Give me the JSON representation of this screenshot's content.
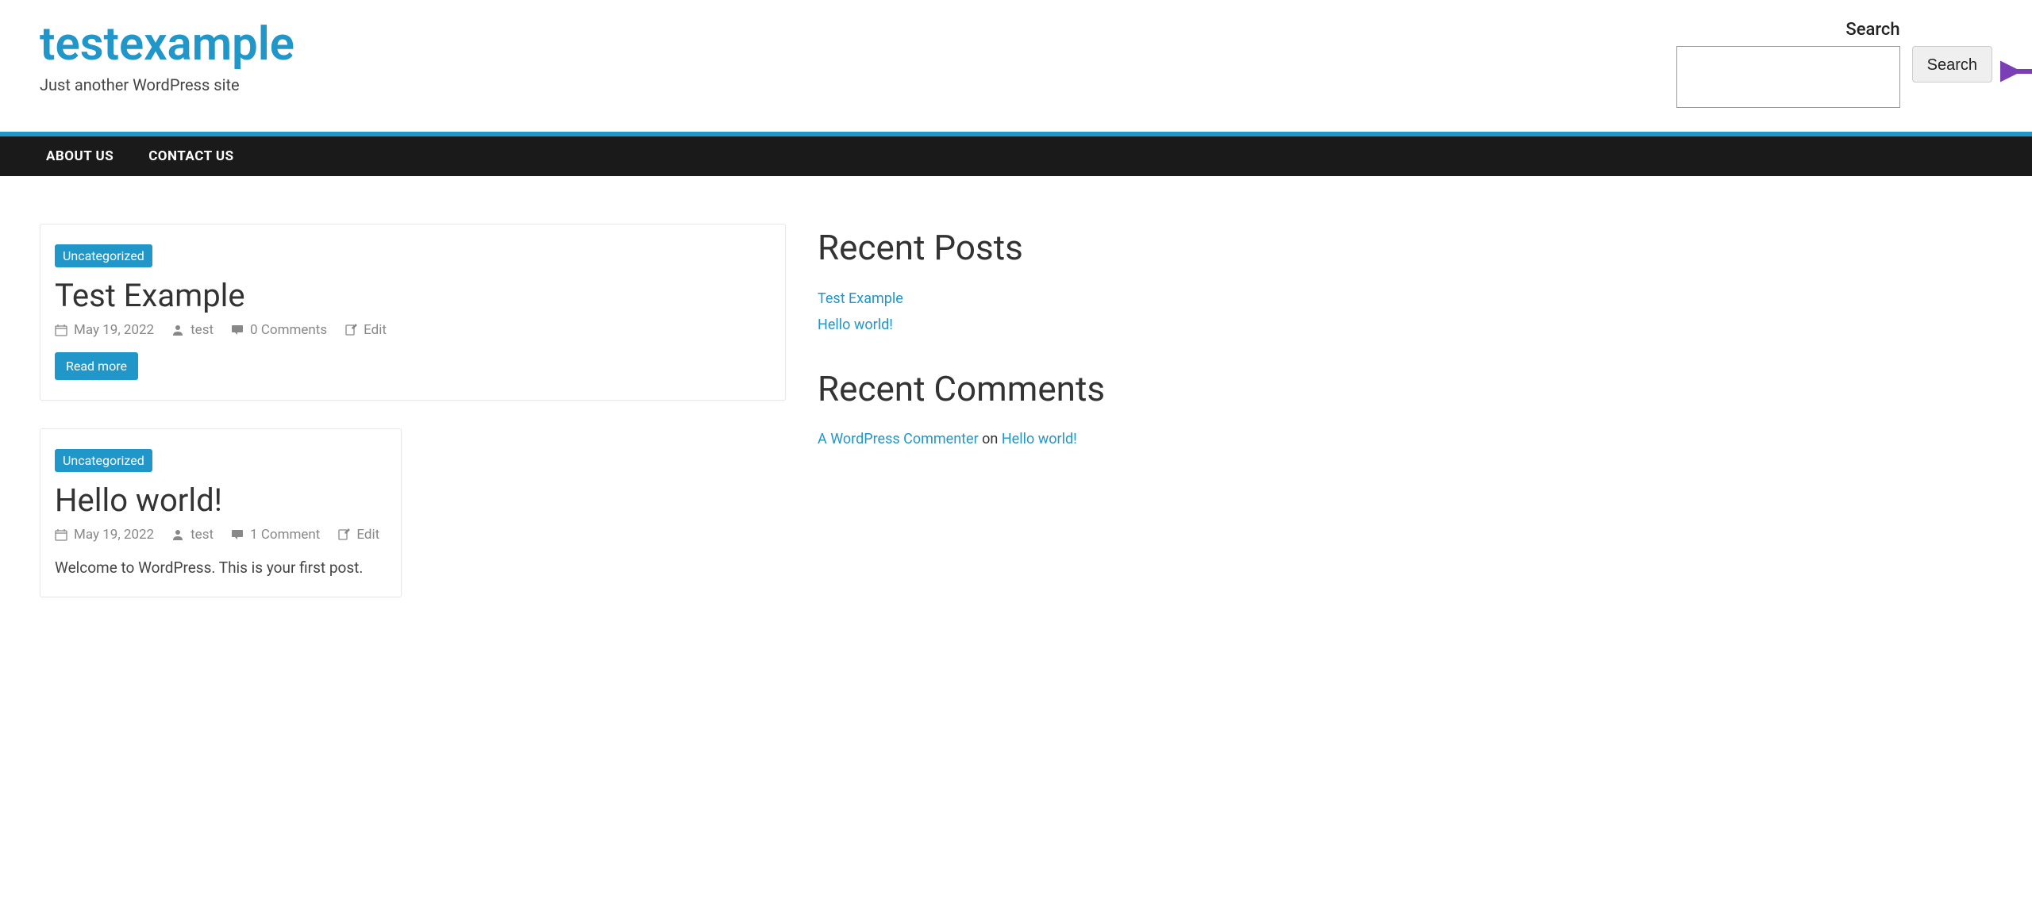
{
  "site": {
    "title": "testexample",
    "tagline": "Just another WordPress site"
  },
  "search": {
    "label": "Search",
    "button": "Search"
  },
  "nav": {
    "items": [
      {
        "label": "ABOUT US"
      },
      {
        "label": "CONTACT US"
      }
    ]
  },
  "posts": [
    {
      "category": "Uncategorized",
      "title": "Test Example",
      "date": "May 19, 2022",
      "author": "test",
      "comments": "0 Comments",
      "edit": "Edit",
      "read_more": "Read more"
    },
    {
      "category": "Uncategorized",
      "title": "Hello world!",
      "date": "May 19, 2022",
      "author": "test",
      "comments": "1 Comment",
      "edit": "Edit",
      "excerpt": "Welcome to WordPress. This is your first post."
    }
  ],
  "sidebar": {
    "recent_posts": {
      "title": "Recent Posts",
      "items": [
        {
          "label": "Test Example"
        },
        {
          "label": "Hello world!"
        }
      ]
    },
    "recent_comments": {
      "title": "Recent Comments",
      "items": [
        {
          "author": "A WordPress Commenter",
          "on": " on ",
          "post": "Hello world!"
        }
      ]
    }
  }
}
